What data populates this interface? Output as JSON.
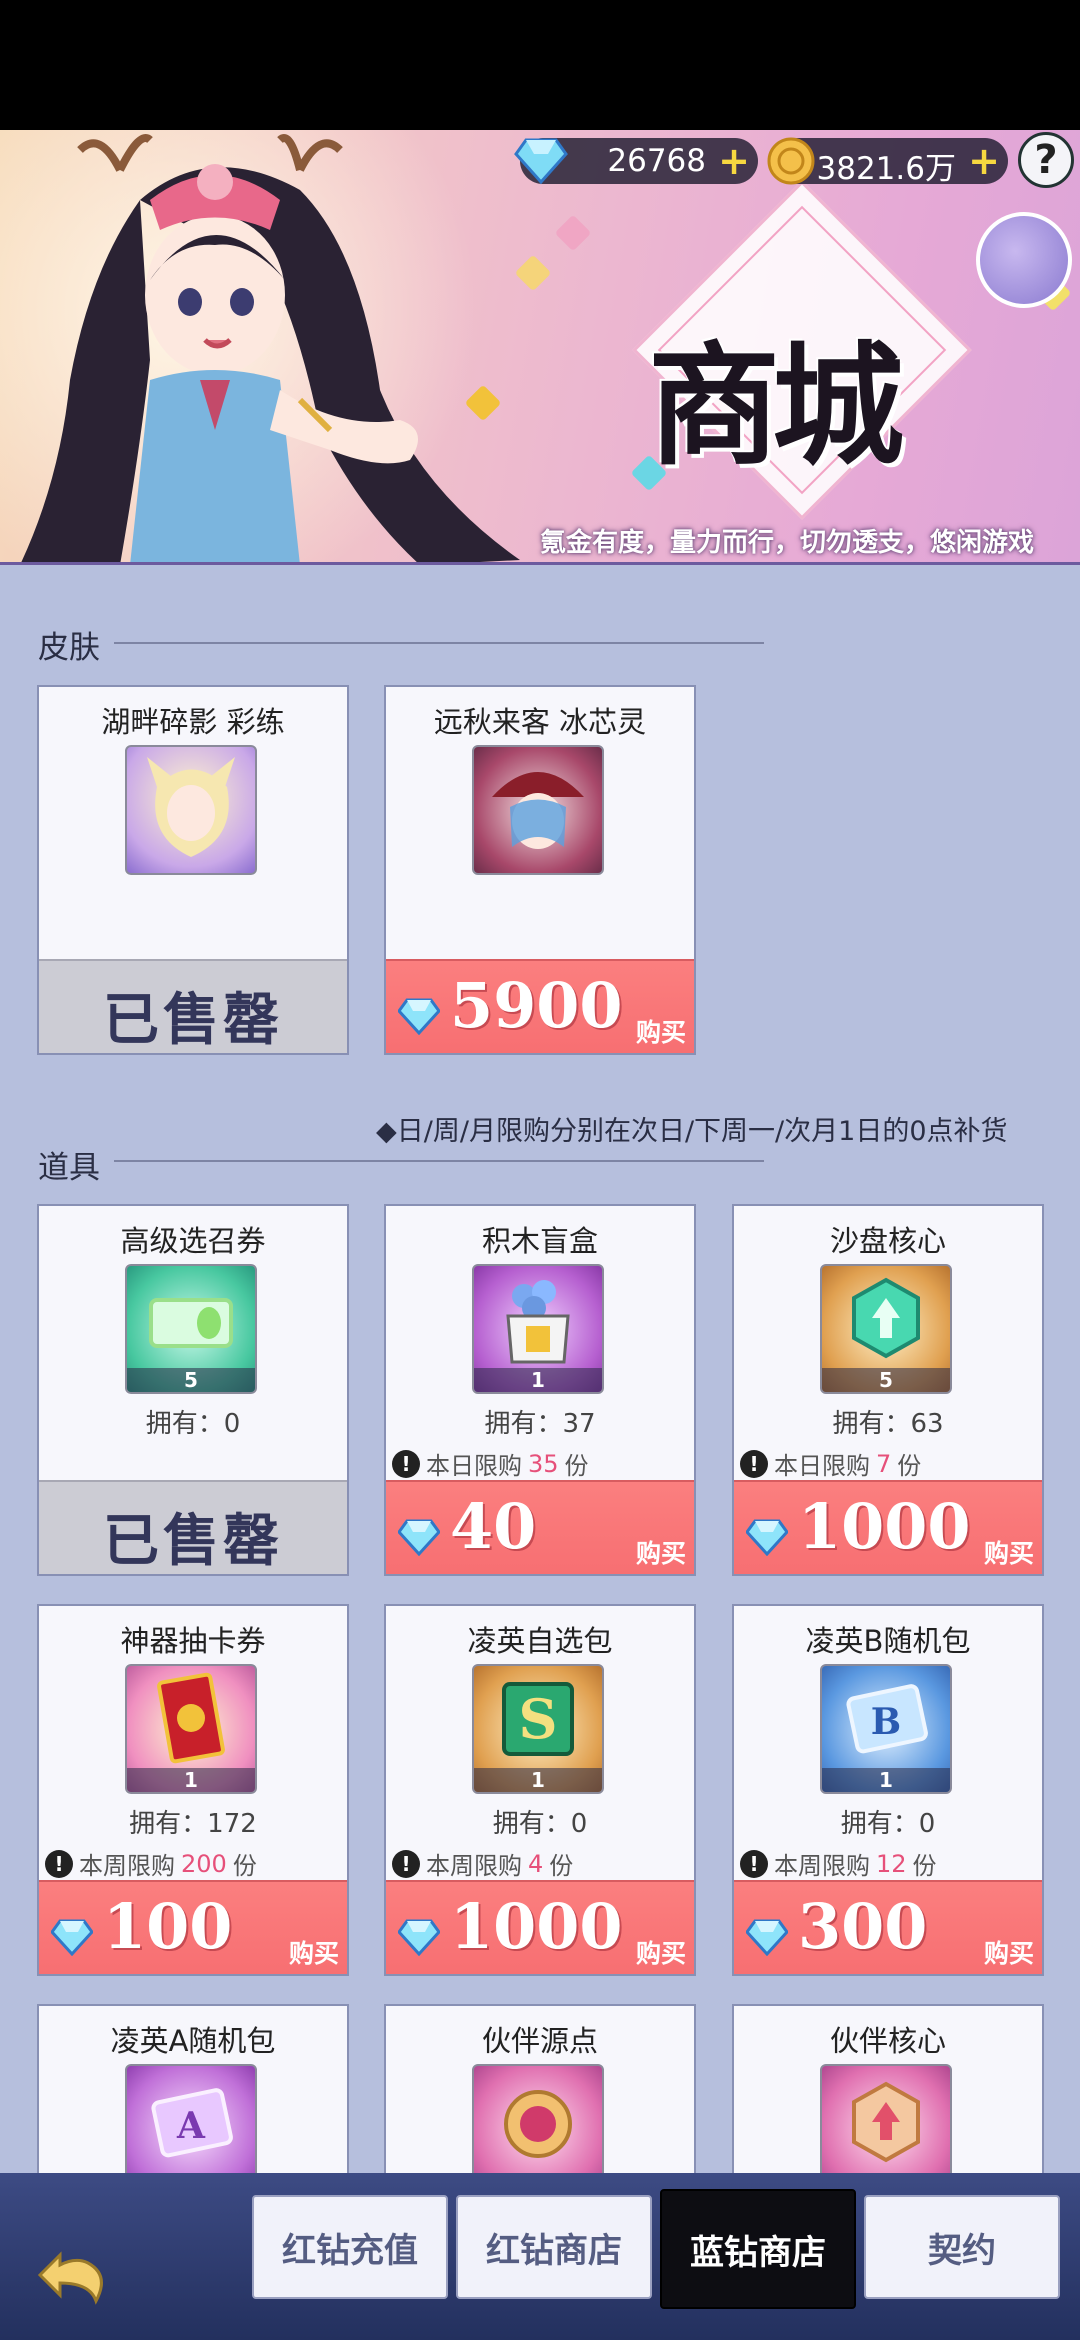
{
  "header": {
    "blue_diamonds": "26768",
    "gold_coins": "3821.6万",
    "help_label": "?",
    "title": "商城",
    "slogan": "氪金有度，量力而行，切勿透支，悠闲游戏"
  },
  "skins": {
    "heading": "皮肤",
    "items": [
      {
        "name": "湖畔碎影 彩练",
        "status": "已售罄"
      },
      {
        "name": "远秋来客 冰芯灵",
        "price": "5900",
        "buy": "购买"
      }
    ]
  },
  "items_section": {
    "heading": "道具",
    "restock_note": "◆日/周/月限购分别在次日/下周一/次月1日的0点补货",
    "items": [
      {
        "name": "高级选召券",
        "qty": "5",
        "owned": "拥有：0",
        "status": "已售罄"
      },
      {
        "name": "积木盲盒",
        "qty": "1",
        "owned": "拥有：37",
        "limit_prefix": "本日限购",
        "limit_num": "35",
        "limit_suffix": "份",
        "price": "40",
        "buy": "购买"
      },
      {
        "name": "沙盘核心",
        "qty": "5",
        "owned": "拥有：63",
        "limit_prefix": "本日限购",
        "limit_num": "7",
        "limit_suffix": "份",
        "price": "1000",
        "buy": "购买"
      },
      {
        "name": "神器抽卡券",
        "qty": "1",
        "owned": "拥有：172",
        "limit_prefix": "本周限购",
        "limit_num": "200",
        "limit_suffix": "份",
        "price": "100",
        "buy": "购买"
      },
      {
        "name": "凌英自选包",
        "qty": "1",
        "owned": "拥有：0",
        "limit_prefix": "本周限购",
        "limit_num": "4",
        "limit_suffix": "份",
        "price": "1000",
        "buy": "购买"
      },
      {
        "name": "凌英B随机包",
        "qty": "1",
        "owned": "拥有：0",
        "limit_prefix": "本周限购",
        "limit_num": "12",
        "limit_suffix": "份",
        "price": "300",
        "buy": "购买"
      },
      {
        "name": "凌英A随机包"
      },
      {
        "name": "伙伴源点"
      },
      {
        "name": "伙伴核心"
      }
    ]
  },
  "nav": {
    "tabs": [
      "红钻充值",
      "红钻商店",
      "蓝钻商店",
      "契约"
    ],
    "active_tab": "蓝钻商店"
  },
  "colors": {
    "price_bar": "#f76f72",
    "limit_number": "#e6507a",
    "sold_out_bar": "#ccccd4",
    "nav_bg": "#2c3a6e"
  }
}
